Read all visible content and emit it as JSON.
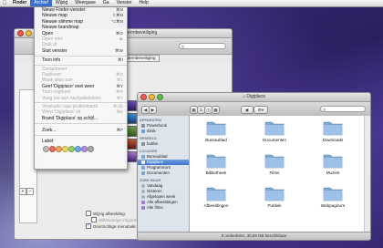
{
  "menubar": {
    "items": [
      "Finder",
      "Archief",
      "Wijzig",
      "Weergave",
      "Ga",
      "Venster",
      "Help"
    ]
  },
  "archief_menu": {
    "items": [
      {
        "label": "Nieuw Finder-venster",
        "shortcut": "⌘N",
        "enabled": true
      },
      {
        "label": "Nieuwe map",
        "shortcut": "⇧⌘N",
        "enabled": true
      },
      {
        "label": "Nieuwe slimme map",
        "shortcut": "⌥⌘N",
        "enabled": true
      },
      {
        "label": "Nieuwe brandmap",
        "shortcut": "",
        "enabled": true
      },
      {
        "label": "Open",
        "shortcut": "⌘O",
        "enabled": true
      },
      {
        "label": "Open met",
        "shortcut": "",
        "enabled": false
      },
      {
        "label": "Druk af",
        "shortcut": "",
        "enabled": false
      },
      {
        "label": "Sluit venster",
        "shortcut": "⌘W",
        "enabled": true
      },
      {
        "label": "Toon info",
        "shortcut": "⌘I",
        "enabled": true
      },
      {
        "label": "Comprimeer",
        "shortcut": "",
        "enabled": false
      },
      {
        "label": "Dupliceer",
        "shortcut": "⌘D",
        "enabled": false
      },
      {
        "label": "Maak alias aan",
        "shortcut": "⌘L",
        "enabled": false
      },
      {
        "label": "Geef 'Digiplace' snel weer",
        "shortcut": "⌘Y",
        "enabled": true
      },
      {
        "label": "Toon origineel",
        "shortcut": "⌘R",
        "enabled": false
      },
      {
        "label": "Voeg toe aan navigatiekolom",
        "shortcut": "⌘T",
        "enabled": false
      },
      {
        "label": "Verplaats naar prullenmand",
        "shortcut": "⌘⌫",
        "enabled": false
      },
      {
        "label": "Werp 'Digiplace' uit",
        "shortcut": "⌘E",
        "enabled": false
      },
      {
        "label": "Brand 'Digiplace' op schijf...",
        "shortcut": "",
        "enabled": true
      },
      {
        "label": "Zoek...",
        "shortcut": "⌘F",
        "enabled": true
      },
      {
        "label": "Label:",
        "shortcut": "",
        "enabled": true
      }
    ],
    "label_colors": [
      "#bdbdbd",
      "#f26b5b",
      "#f5a35a",
      "#f3da5b",
      "#8fd16a",
      "#6aa9f0",
      "#b98be0",
      "#a9a9a9"
    ]
  },
  "pref_window": {
    "title": "Bureaubladachtergrond en schermbeveiliging",
    "title_visible": "ermbeveiliging",
    "tab_label": "Schermbeveiliging",
    "search_placeholder": "",
    "check_change": "Wijzig afbeelding:",
    "check_change_detail": "elke 30 minuten",
    "check_random": "Willekeurige volgorde",
    "check_translucent": "Doorzichtige menubalk",
    "plus_label": "+",
    "minus_label": "−"
  },
  "finder": {
    "title": "Digiplace",
    "search_placeholder": "",
    "sidebar": [
      {
        "type": "head",
        "label": "APPARATEN"
      },
      {
        "type": "item",
        "label": "Powerbook",
        "icon": "laptop-icon"
      },
      {
        "type": "item",
        "label": "iDisk",
        "icon": "idisk-icon"
      },
      {
        "type": "head",
        "label": "GEDEELD"
      },
      {
        "type": "item",
        "label": "bubbs",
        "icon": "network-icon"
      },
      {
        "type": "head",
        "label": "LOCATIES"
      },
      {
        "type": "item",
        "label": "Bureaublad",
        "icon": "desktop-icon"
      },
      {
        "type": "item",
        "label": "Digiplace",
        "icon": "home-icon",
        "selected": true
      },
      {
        "type": "item",
        "label": "Programma's",
        "icon": "apps-icon"
      },
      {
        "type": "item",
        "label": "Documenten",
        "icon": "documents-icon"
      },
      {
        "type": "head",
        "label": "ZOEK NAAR"
      },
      {
        "type": "item",
        "label": "Vandaag",
        "icon": "clock-icon"
      },
      {
        "type": "item",
        "label": "Gisteren",
        "icon": "clock-icon"
      },
      {
        "type": "item",
        "label": "Afgelopen week",
        "icon": "clock-icon"
      },
      {
        "type": "item",
        "label": "Alle afbeeldingen",
        "icon": "smart-folder-icon"
      },
      {
        "type": "item",
        "label": "Alle films",
        "icon": "smart-folder-icon"
      }
    ],
    "folders": [
      "Bureaublad",
      "Documenten",
      "Downloads",
      "Bibliotheek",
      "Films",
      "Muziek",
      "Afbeeldingen",
      "Publiek",
      "Webpagina's"
    ],
    "status": "9 onderdelen, 30,59 GB beschikbaar"
  }
}
